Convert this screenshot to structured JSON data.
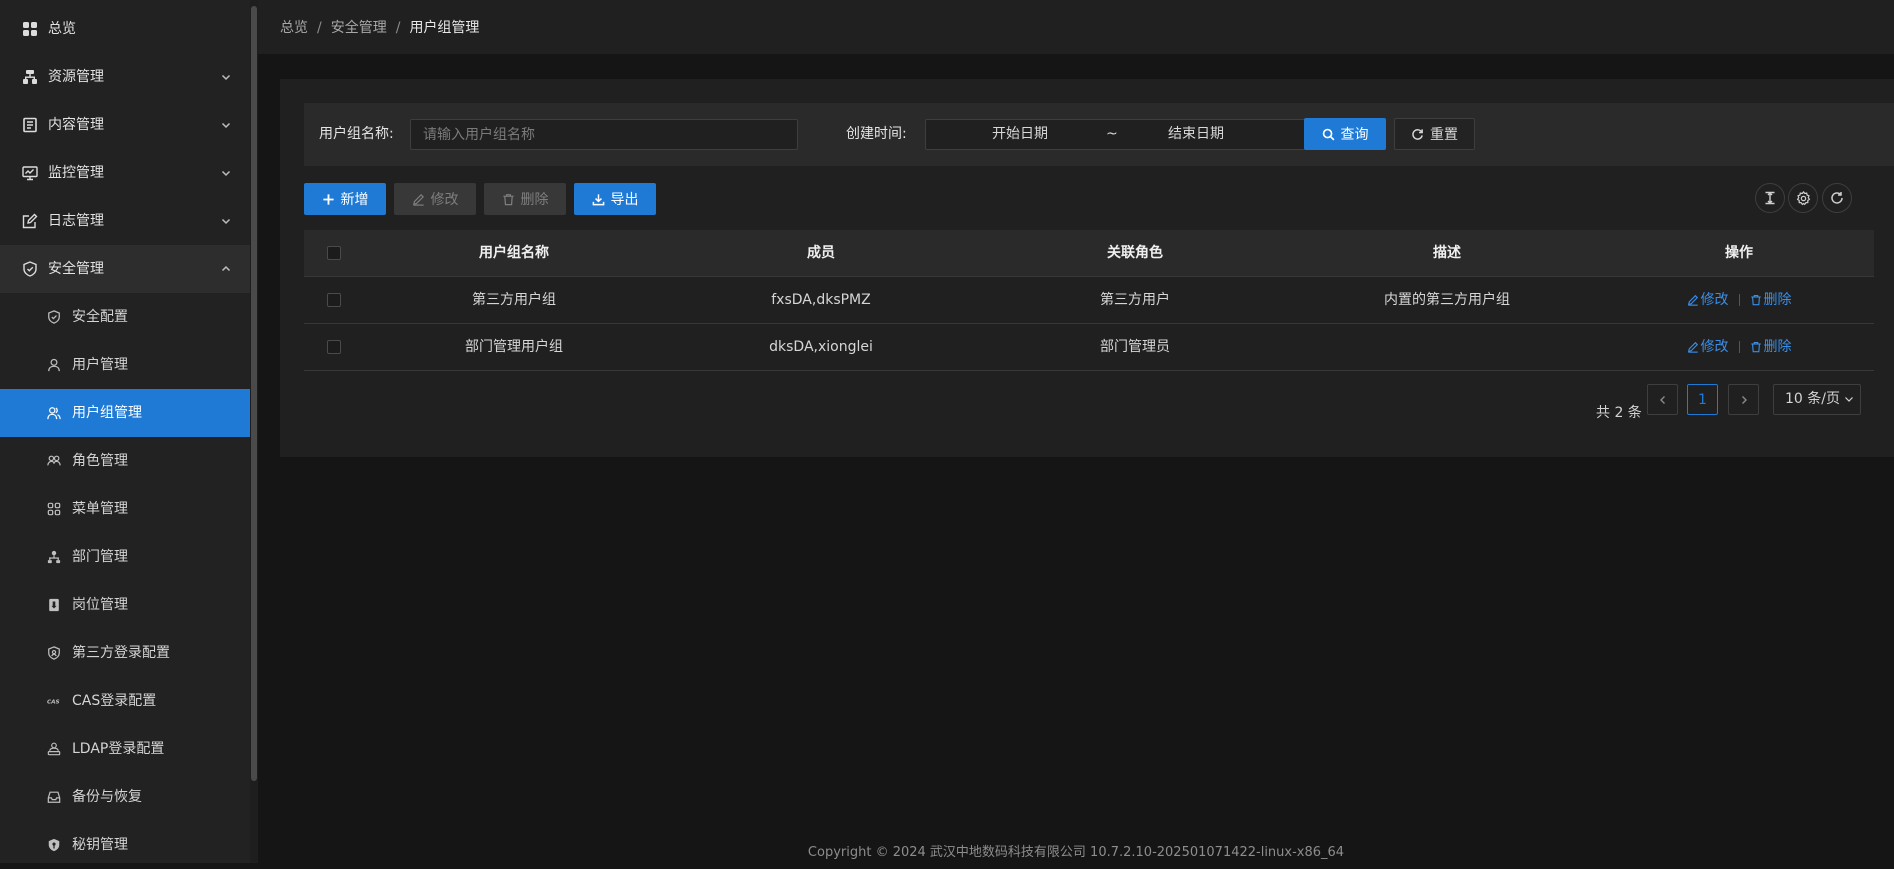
{
  "sidebar": {
    "menu": [
      {
        "label": "总览",
        "icon": "dashboard-icon"
      },
      {
        "label": "资源管理",
        "icon": "resource-icon"
      },
      {
        "label": "内容管理",
        "icon": "content-icon"
      },
      {
        "label": "监控管理",
        "icon": "monitor-icon"
      },
      {
        "label": "日志管理",
        "icon": "log-icon"
      },
      {
        "label": "安全管理",
        "icon": "shield-icon"
      }
    ],
    "security_children": [
      {
        "label": "安全配置",
        "icon": "shield-check-icon"
      },
      {
        "label": "用户管理",
        "icon": "user-icon"
      },
      {
        "label": "用户组管理",
        "icon": "user-group-icon"
      },
      {
        "label": "角色管理",
        "icon": "role-icon"
      },
      {
        "label": "菜单管理",
        "icon": "menu-grid-icon"
      },
      {
        "label": "部门管理",
        "icon": "org-tree-icon"
      },
      {
        "label": "岗位管理",
        "icon": "post-icon"
      },
      {
        "label": "第三方登录配置",
        "icon": "third-party-shield-icon"
      },
      {
        "label": "CAS登录配置",
        "icon": "cas-icon"
      },
      {
        "label": "LDAP登录配置",
        "icon": "ldap-icon"
      },
      {
        "label": "备份与恢复",
        "icon": "backup-icon"
      },
      {
        "label": "秘钥管理",
        "icon": "key-shield-icon"
      }
    ],
    "active_item": "用户组管理"
  },
  "breadcrumb": [
    "总览",
    "安全管理",
    "用户组管理"
  ],
  "breadcrumb_separator": "/",
  "filters": {
    "name_label": "用户组名称:",
    "name_value": "",
    "name_placeholder": "请输入用户组名称",
    "time_label": "创建时间:",
    "start_placeholder": "开始日期",
    "range_separator": "~",
    "end_placeholder": "结束日期",
    "search_label": "查询",
    "reset_label": "重置"
  },
  "toolbar": {
    "add_label": "新增",
    "edit_label": "修改",
    "delete_label": "删除",
    "export_label": "导出",
    "right_icons": [
      "column-height-icon",
      "settings-icon",
      "refresh-icon"
    ]
  },
  "table": {
    "headers": {
      "name": "用户组名称",
      "members": "成员",
      "roles": "关联角色",
      "description": "描述",
      "actions": "操作"
    },
    "rows": [
      {
        "name": "第三方用户组",
        "members": "fxsDA,dksPMZ",
        "roles": "第三方用户",
        "description": "内置的第三方用户组"
      },
      {
        "name": "部门管理用户组",
        "members": "dksDA,xionglei",
        "roles": "部门管理员",
        "description": ""
      }
    ],
    "row_actions": {
      "edit": "修改",
      "delete": "删除"
    }
  },
  "pagination": {
    "total_text": "共 2 条",
    "current_page": "1",
    "page_size": "10 条/页"
  },
  "footer": "Copyright © 2024 武汉中地数码科技有限公司 10.7.2.10-202501071422-linux-x86_64",
  "colors": {
    "accent": "#1f7ad6",
    "link": "#3a8ee8",
    "background": "#151515",
    "sidebar": "#222222",
    "panel": "#202020"
  }
}
